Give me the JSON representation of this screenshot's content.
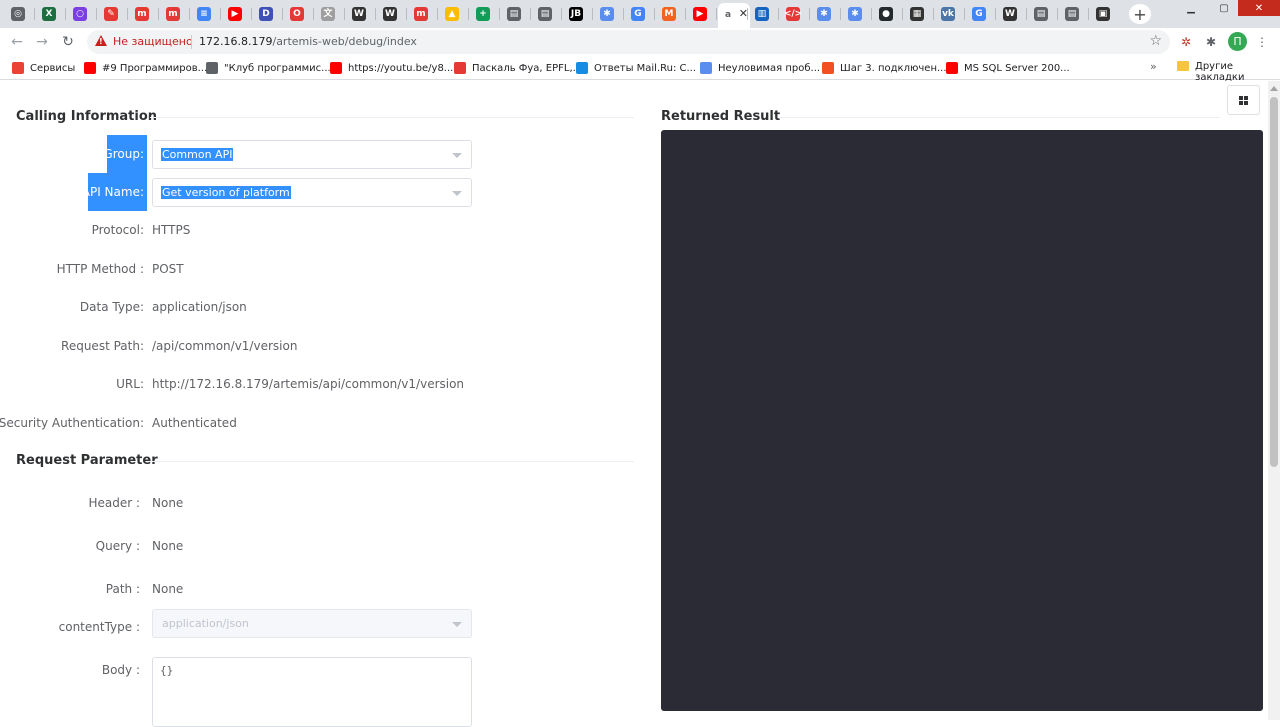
{
  "browser": {
    "tabs": [
      {
        "icon": "chrome-icon",
        "color": "#5f6368",
        "glyph": "◎"
      },
      {
        "icon": "excel-icon",
        "color": "#1d6f42",
        "glyph": "X"
      },
      {
        "icon": "circle-icon",
        "color": "#7b3fe4",
        "glyph": "○"
      },
      {
        "icon": "tool-icon",
        "color": "#e53935",
        "glyph": "✎"
      },
      {
        "icon": "m-icon",
        "color": "#e53935",
        "glyph": "m"
      },
      {
        "icon": "m-icon",
        "color": "#e53935",
        "glyph": "m"
      },
      {
        "icon": "docs-icon",
        "color": "#4285f4",
        "glyph": "≡"
      },
      {
        "icon": "youtube-icon",
        "color": "#ff0000",
        "glyph": "▶"
      },
      {
        "icon": "d-icon",
        "color": "#3f51b5",
        "glyph": "D"
      },
      {
        "icon": "opera-icon",
        "color": "#e53935",
        "glyph": "O"
      },
      {
        "icon": "translate-icon",
        "color": "#9e9e9e",
        "glyph": "文"
      },
      {
        "icon": "wikipedia-icon",
        "color": "#333333",
        "glyph": "W"
      },
      {
        "icon": "wikipedia-icon",
        "color": "#333333",
        "glyph": "W"
      },
      {
        "icon": "m-icon",
        "color": "#e53935",
        "glyph": "m"
      },
      {
        "icon": "drive-icon",
        "color": "#fbbc04",
        "glyph": "▲"
      },
      {
        "icon": "sheets-icon",
        "color": "#0f9d58",
        "glyph": "+"
      },
      {
        "icon": "page-icon",
        "color": "#5f6368",
        "glyph": "▤"
      },
      {
        "icon": "page-icon",
        "color": "#5f6368",
        "glyph": "▤"
      },
      {
        "icon": "jetbrains-icon",
        "color": "#000000",
        "glyph": "JB"
      },
      {
        "icon": "puzzle-icon",
        "color": "#5b8def",
        "glyph": "✱"
      },
      {
        "icon": "google-icon",
        "color": "#4285f4",
        "glyph": "G"
      },
      {
        "icon": "magento-icon",
        "color": "#f26322",
        "glyph": "M"
      },
      {
        "icon": "youtube-icon",
        "color": "#ff0000",
        "glyph": "▶"
      },
      {
        "icon": "active-tab-icon",
        "color": "#5f6368",
        "glyph": "a"
      },
      {
        "icon": "book-icon",
        "color": "#1565c0",
        "glyph": "▥"
      },
      {
        "icon": "code-icon",
        "color": "#e53935",
        "glyph": "</>"
      },
      {
        "icon": "puzzle-icon",
        "color": "#5b8def",
        "glyph": "✱"
      },
      {
        "icon": "puzzle-icon",
        "color": "#5b8def",
        "glyph": "✱"
      },
      {
        "icon": "github-icon",
        "color": "#24292e",
        "glyph": "●"
      },
      {
        "icon": "grid-app-icon",
        "color": "#333333",
        "glyph": "▦"
      },
      {
        "icon": "vk-icon",
        "color": "#4a76a8",
        "glyph": "vk"
      },
      {
        "icon": "google-icon",
        "color": "#4285f4",
        "glyph": "G"
      },
      {
        "icon": "wikipedia-icon",
        "color": "#333333",
        "glyph": "W"
      },
      {
        "icon": "page-icon",
        "color": "#5f6368",
        "glyph": "▤"
      },
      {
        "icon": "page-icon",
        "color": "#5f6368",
        "glyph": "▤"
      },
      {
        "icon": "page-icon",
        "color": "#333333",
        "glyph": "▣"
      }
    ],
    "active_tab_index": 23,
    "insecure_label": "Не защищено",
    "url_host": "172.16.8.179",
    "url_path": "/artemis-web/debug/index",
    "bookmarks": [
      {
        "label": "Сервисы",
        "icon": "apps-icon",
        "color": "#ea4335"
      },
      {
        "label": "#9 Программиров...",
        "icon": "youtube-icon",
        "color": "#ff0000"
      },
      {
        "label": "\"Клуб программис...",
        "icon": "globe-icon",
        "color": "#5f6368"
      },
      {
        "label": "https://youtu.be/y8...",
        "icon": "youtube-icon",
        "color": "#ff0000"
      },
      {
        "label": "Паскаль Фуа, EPFL,...",
        "icon": "x-icon",
        "color": "#e53935"
      },
      {
        "label": "Ответы Mail.Ru: С...",
        "icon": "mailru-icon",
        "color": "#168de2"
      },
      {
        "label": "Неуловимая проб...",
        "icon": "puzzle-icon",
        "color": "#5b8def"
      },
      {
        "label": "Шаг 3. подключен...",
        "icon": "windows-icon",
        "color": "#f25022"
      },
      {
        "label": "MS SQL Server 200...",
        "icon": "youtube-icon",
        "color": "#ff0000"
      }
    ],
    "bookmarks_more": "»",
    "other_bookmarks": "Другие закладки",
    "profile_letter": "П"
  },
  "calling": {
    "title": "Calling Information",
    "group_label": "Group:",
    "group_value": "Common API",
    "api_name_label": "API Name:",
    "api_name_value": "Get version of platform",
    "protocol_label": "Protocol:",
    "protocol_value": "HTTPS",
    "method_label": "HTTP Method :",
    "method_value": "POST",
    "datatype_label": "Data Type:",
    "datatype_value": "application/json",
    "path_label": "Request Path:",
    "path_value": "/api/common/v1/version",
    "url_label": "URL:",
    "url_value": "http://172.16.8.179/artemis/api/common/v1/version",
    "security_label": "Security Authentication:",
    "security_value": "Authenticated"
  },
  "request": {
    "title": "Request Parameter",
    "header_label": "Header :",
    "header_value": "None",
    "query_label": "Query :",
    "query_value": "None",
    "path_label": "Path :",
    "path_value": "None",
    "content_type_label": "contentType :",
    "content_type_value": "application/json",
    "body_label": "Body :",
    "body_value": "{}"
  },
  "result": {
    "title": "Returned Result",
    "box_color": "#2b2b36"
  },
  "accent_color": "#3390ff"
}
